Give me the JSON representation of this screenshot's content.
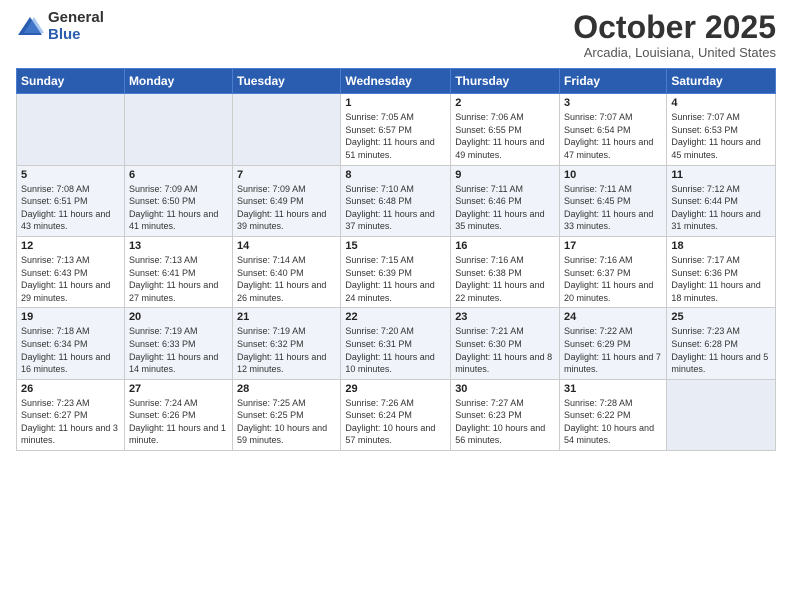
{
  "logo": {
    "general": "General",
    "blue": "Blue"
  },
  "header": {
    "month": "October 2025",
    "location": "Arcadia, Louisiana, United States"
  },
  "days_of_week": [
    "Sunday",
    "Monday",
    "Tuesday",
    "Wednesday",
    "Thursday",
    "Friday",
    "Saturday"
  ],
  "weeks": [
    [
      {
        "num": "",
        "info": ""
      },
      {
        "num": "",
        "info": ""
      },
      {
        "num": "",
        "info": ""
      },
      {
        "num": "1",
        "info": "Sunrise: 7:05 AM\nSunset: 6:57 PM\nDaylight: 11 hours\nand 51 minutes."
      },
      {
        "num": "2",
        "info": "Sunrise: 7:06 AM\nSunset: 6:55 PM\nDaylight: 11 hours\nand 49 minutes."
      },
      {
        "num": "3",
        "info": "Sunrise: 7:07 AM\nSunset: 6:54 PM\nDaylight: 11 hours\nand 47 minutes."
      },
      {
        "num": "4",
        "info": "Sunrise: 7:07 AM\nSunset: 6:53 PM\nDaylight: 11 hours\nand 45 minutes."
      }
    ],
    [
      {
        "num": "5",
        "info": "Sunrise: 7:08 AM\nSunset: 6:51 PM\nDaylight: 11 hours\nand 43 minutes."
      },
      {
        "num": "6",
        "info": "Sunrise: 7:09 AM\nSunset: 6:50 PM\nDaylight: 11 hours\nand 41 minutes."
      },
      {
        "num": "7",
        "info": "Sunrise: 7:09 AM\nSunset: 6:49 PM\nDaylight: 11 hours\nand 39 minutes."
      },
      {
        "num": "8",
        "info": "Sunrise: 7:10 AM\nSunset: 6:48 PM\nDaylight: 11 hours\nand 37 minutes."
      },
      {
        "num": "9",
        "info": "Sunrise: 7:11 AM\nSunset: 6:46 PM\nDaylight: 11 hours\nand 35 minutes."
      },
      {
        "num": "10",
        "info": "Sunrise: 7:11 AM\nSunset: 6:45 PM\nDaylight: 11 hours\nand 33 minutes."
      },
      {
        "num": "11",
        "info": "Sunrise: 7:12 AM\nSunset: 6:44 PM\nDaylight: 11 hours\nand 31 minutes."
      }
    ],
    [
      {
        "num": "12",
        "info": "Sunrise: 7:13 AM\nSunset: 6:43 PM\nDaylight: 11 hours\nand 29 minutes."
      },
      {
        "num": "13",
        "info": "Sunrise: 7:13 AM\nSunset: 6:41 PM\nDaylight: 11 hours\nand 27 minutes."
      },
      {
        "num": "14",
        "info": "Sunrise: 7:14 AM\nSunset: 6:40 PM\nDaylight: 11 hours\nand 26 minutes."
      },
      {
        "num": "15",
        "info": "Sunrise: 7:15 AM\nSunset: 6:39 PM\nDaylight: 11 hours\nand 24 minutes."
      },
      {
        "num": "16",
        "info": "Sunrise: 7:16 AM\nSunset: 6:38 PM\nDaylight: 11 hours\nand 22 minutes."
      },
      {
        "num": "17",
        "info": "Sunrise: 7:16 AM\nSunset: 6:37 PM\nDaylight: 11 hours\nand 20 minutes."
      },
      {
        "num": "18",
        "info": "Sunrise: 7:17 AM\nSunset: 6:36 PM\nDaylight: 11 hours\nand 18 minutes."
      }
    ],
    [
      {
        "num": "19",
        "info": "Sunrise: 7:18 AM\nSunset: 6:34 PM\nDaylight: 11 hours\nand 16 minutes."
      },
      {
        "num": "20",
        "info": "Sunrise: 7:19 AM\nSunset: 6:33 PM\nDaylight: 11 hours\nand 14 minutes."
      },
      {
        "num": "21",
        "info": "Sunrise: 7:19 AM\nSunset: 6:32 PM\nDaylight: 11 hours\nand 12 minutes."
      },
      {
        "num": "22",
        "info": "Sunrise: 7:20 AM\nSunset: 6:31 PM\nDaylight: 11 hours\nand 10 minutes."
      },
      {
        "num": "23",
        "info": "Sunrise: 7:21 AM\nSunset: 6:30 PM\nDaylight: 11 hours\nand 8 minutes."
      },
      {
        "num": "24",
        "info": "Sunrise: 7:22 AM\nSunset: 6:29 PM\nDaylight: 11 hours\nand 7 minutes."
      },
      {
        "num": "25",
        "info": "Sunrise: 7:23 AM\nSunset: 6:28 PM\nDaylight: 11 hours\nand 5 minutes."
      }
    ],
    [
      {
        "num": "26",
        "info": "Sunrise: 7:23 AM\nSunset: 6:27 PM\nDaylight: 11 hours\nand 3 minutes."
      },
      {
        "num": "27",
        "info": "Sunrise: 7:24 AM\nSunset: 6:26 PM\nDaylight: 11 hours\nand 1 minute."
      },
      {
        "num": "28",
        "info": "Sunrise: 7:25 AM\nSunset: 6:25 PM\nDaylight: 10 hours\nand 59 minutes."
      },
      {
        "num": "29",
        "info": "Sunrise: 7:26 AM\nSunset: 6:24 PM\nDaylight: 10 hours\nand 57 minutes."
      },
      {
        "num": "30",
        "info": "Sunrise: 7:27 AM\nSunset: 6:23 PM\nDaylight: 10 hours\nand 56 minutes."
      },
      {
        "num": "31",
        "info": "Sunrise: 7:28 AM\nSunset: 6:22 PM\nDaylight: 10 hours\nand 54 minutes."
      },
      {
        "num": "",
        "info": ""
      }
    ]
  ]
}
